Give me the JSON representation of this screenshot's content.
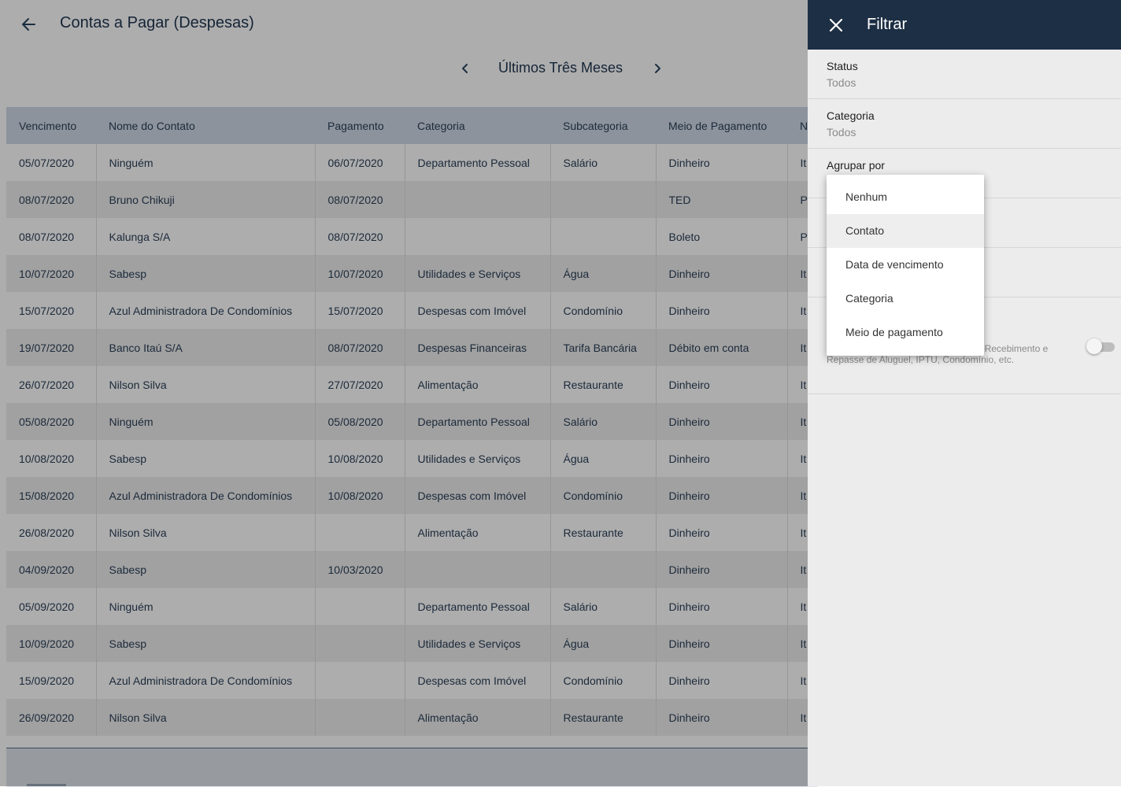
{
  "header": {
    "title": "Contas a Pagar (Despesas)",
    "back_icon": "arrow-left-icon"
  },
  "period": {
    "label": "Últimos Três Meses",
    "prev_icon": "chevron-left-icon",
    "next_icon": "chevron-right-icon"
  },
  "table": {
    "columns": [
      "Vencimento",
      "Nome do Contato",
      "Pagamento",
      "Categoria",
      "Subcategoria",
      "Meio de Pagamento",
      "N"
    ],
    "rows": [
      [
        "05/07/2020",
        "Ninguém",
        "06/07/2020",
        "Departamento Pessoal",
        "Salário",
        "Dinheiro",
        "It"
      ],
      [
        "08/07/2020",
        "Bruno Chikuji",
        "08/07/2020",
        "",
        "",
        "TED",
        "P"
      ],
      [
        "08/07/2020",
        "Kalunga S/A",
        "08/07/2020",
        "",
        "",
        "Boleto",
        "P"
      ],
      [
        "10/07/2020",
        "Sabesp",
        "10/07/2020",
        "Utilidades e Serviços",
        "Água",
        "Dinheiro",
        "It"
      ],
      [
        "15/07/2020",
        "Azul Administradora De Condomínios",
        "15/07/2020",
        "Despesas com Imóvel",
        "Condomínio",
        "Dinheiro",
        "It"
      ],
      [
        "19/07/2020",
        "Banco Itaú S/A",
        "08/07/2020",
        "Despesas Financeiras",
        "Tarifa Bancária",
        "Débito em conta",
        "It"
      ],
      [
        "26/07/2020",
        "Nilson Silva",
        "27/07/2020",
        "Alimentação",
        "Restaurante",
        "Dinheiro",
        "It"
      ],
      [
        "05/08/2020",
        "Ninguém",
        "05/08/2020",
        "Departamento Pessoal",
        "Salário",
        "Dinheiro",
        "It"
      ],
      [
        "10/08/2020",
        "Sabesp",
        "10/08/2020",
        "Utilidades e Serviços",
        "Água",
        "Dinheiro",
        "It"
      ],
      [
        "15/08/2020",
        "Azul Administradora De Condomínios",
        "10/08/2020",
        "Despesas com Imóvel",
        "Condomínio",
        "Dinheiro",
        "It"
      ],
      [
        "26/08/2020",
        "Nilson Silva",
        "",
        "Alimentação",
        "Restaurante",
        "Dinheiro",
        "It"
      ],
      [
        "04/09/2020",
        "Sabesp",
        "10/03/2020",
        "",
        "",
        "Dinheiro",
        "It"
      ],
      [
        "05/09/2020",
        "Ninguém",
        "",
        "Departamento Pessoal",
        "Salário",
        "Dinheiro",
        "It"
      ],
      [
        "10/09/2020",
        "Sabesp",
        "",
        "Utilidades e Serviços",
        "Água",
        "Dinheiro",
        "It"
      ],
      [
        "15/09/2020",
        "Azul Administradora De Condomínios",
        "",
        "Despesas com Imóvel",
        "Condomínio",
        "Dinheiro",
        "It"
      ],
      [
        "26/09/2020",
        "Nilson Silva",
        "",
        "Alimentação",
        "Restaurante",
        "Dinheiro",
        "It"
      ]
    ]
  },
  "filter": {
    "title": "Filtrar",
    "close_icon": "close-icon",
    "status": {
      "label": "Status",
      "value": "Todos"
    },
    "categoria": {
      "label": "Categoria",
      "value": "Todos"
    },
    "agrupar": {
      "label": "Agrupar por"
    },
    "toggle_description": "ria \"Terceiros (Administração)\", como Recebimento e Repasse de Aluguel, IPTU, Condomínio, etc.",
    "toggle_on": false
  },
  "group_dropdown": {
    "selected": "Contato",
    "options": [
      "Nenhum",
      "Contato",
      "Data de vencimento",
      "Categoria",
      "Meio de pagamento"
    ]
  },
  "colors": {
    "header_dark": "#1d2f44",
    "table_header": "#cfd9e6",
    "overlay": "rgba(0,0,0,0.32)"
  }
}
